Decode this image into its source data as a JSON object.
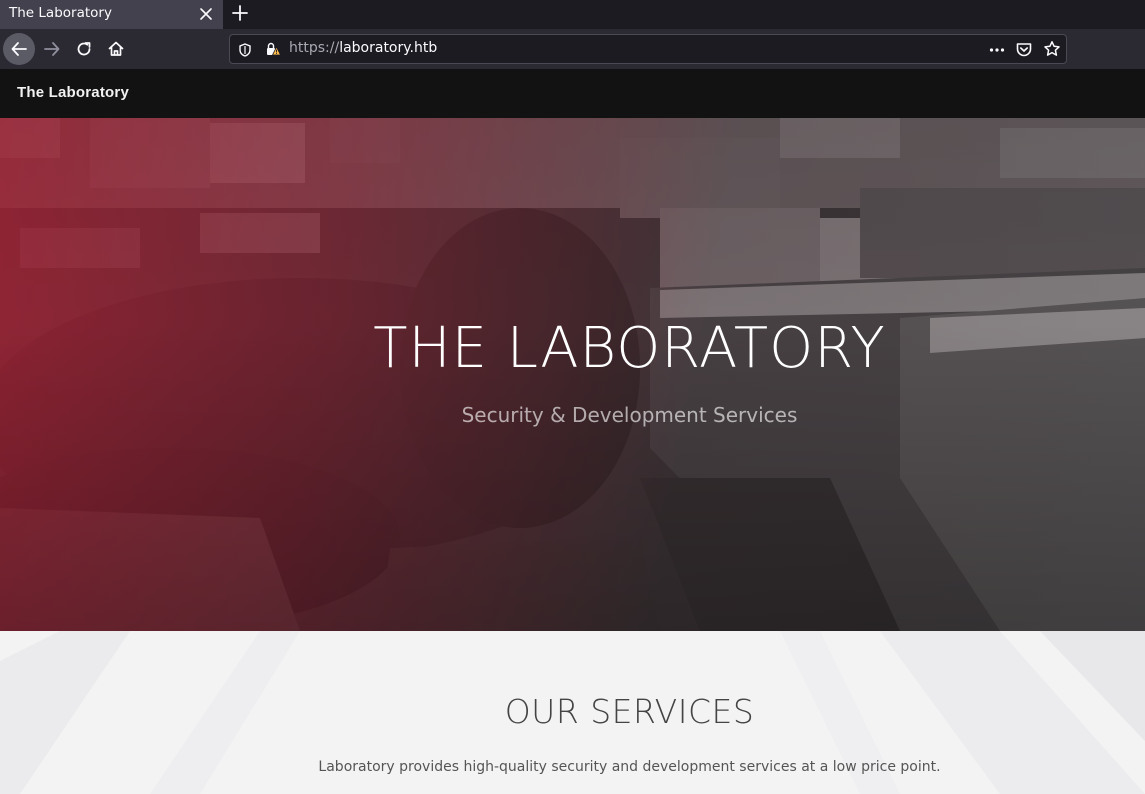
{
  "browser": {
    "tab": {
      "title": "The Laboratory",
      "close_icon": "close-icon"
    },
    "new_tab_icon": "plus-icon",
    "nav": {
      "back_icon": "arrow-left-icon",
      "forward_icon": "arrow-right-icon",
      "reload_icon": "reload-icon",
      "home_icon": "home-icon"
    },
    "urlbar": {
      "scheme": "https://",
      "host": "laboratory.htb",
      "shield_icon": "shield-icon",
      "lock_icon": "lock-warning-icon",
      "more_icon": "more-dots-icon",
      "pocket_icon": "pocket-icon",
      "bookmark_icon": "star-icon"
    },
    "colors": {
      "tabbar_bg": "#1c1b22",
      "active_tab_bg": "#42414d",
      "toolbar_bg": "#2b2a33",
      "warning_yellow": "#ffbd4f"
    }
  },
  "site": {
    "nav": {
      "brand": "The Laboratory"
    },
    "hero": {
      "title": "THE LABORATORY",
      "subtitle": "Security & Development Services"
    },
    "services": {
      "title": "OUR SERVICES",
      "description": "Laboratory provides high-quality security and development services at a low price point."
    },
    "colors": {
      "nav_bg": "#121212",
      "hero_overlay": "#a82034",
      "section_bg": "#f3f3f4"
    }
  }
}
